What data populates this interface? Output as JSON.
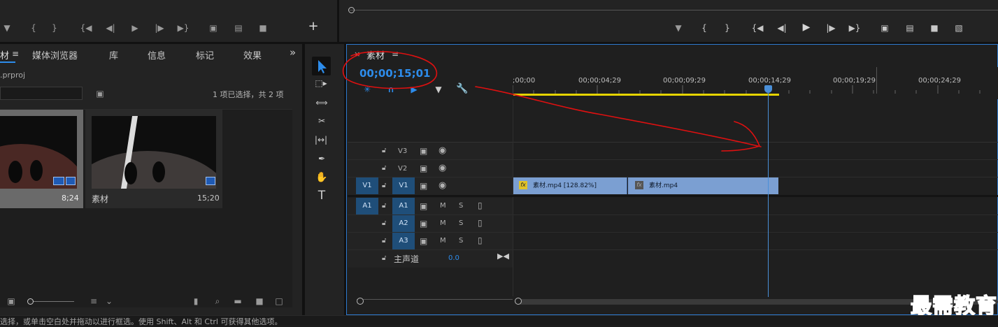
{
  "source_monitor": {
    "transport": [
      "marker-icon",
      "mark-in-icon",
      "mark-out-icon",
      "go-to-in-icon",
      "step-back-icon",
      "play-icon",
      "step-forward-icon",
      "go-to-out-icon",
      "insert-icon",
      "overwrite-icon",
      "export-frame-icon"
    ],
    "add_button": "+"
  },
  "program_monitor": {
    "transport": [
      "marker-icon",
      "mark-in-icon",
      "mark-out-icon",
      "go-to-in-icon",
      "step-back-icon",
      "play-icon",
      "step-forward-icon",
      "go-to-out-icon",
      "lift-icon",
      "extract-icon",
      "export-frame-icon",
      "compare-icon"
    ]
  },
  "project_panel": {
    "tabs": [
      "材",
      "媒体浏览器",
      "库",
      "信息",
      "标记",
      "效果"
    ],
    "more": "»",
    "file_name": ".prproj",
    "selection_status": "1 项已选择，共 2 项",
    "items": [
      {
        "name": "",
        "duration": "8;24"
      },
      {
        "name": "素材",
        "duration": "15;20"
      }
    ]
  },
  "timeline": {
    "sequence_name": "素材",
    "close": "×",
    "menu": "≡",
    "timecode": "00;00;15;01",
    "ruler_labels": [
      ";00;00",
      "00;00;04;29",
      "00;00;09;29",
      "00;00;14;29",
      "00;00;19;29",
      "00;00;24;29"
    ],
    "video_tracks": [
      {
        "name": "V3",
        "source": ""
      },
      {
        "name": "V2",
        "source": ""
      },
      {
        "name": "V1",
        "source": "V1"
      }
    ],
    "audio_tracks": [
      {
        "name": "A1",
        "source": "A1"
      },
      {
        "name": "A2",
        "source": ""
      },
      {
        "name": "A3",
        "source": ""
      }
    ],
    "mute": "M",
    "solo": "S",
    "master_label": "主声道",
    "master_value": "0.0",
    "clips": [
      {
        "name": "素材.mp4 [128.82%]",
        "badge": "fx"
      },
      {
        "name": "素材.mp4",
        "badge": "fx"
      }
    ]
  },
  "status_bar": {
    "text": "选择，或单击空白处并拖动以进行框选。使用 Shift、Alt 和 Ctrl 可获得其他选项。"
  },
  "watermark": "最需教育",
  "colors": {
    "accent_blue": "#2d8ceb",
    "clip_blue": "#7b9fd2",
    "work_area": "#e6d400",
    "annotation_red": "#e01010"
  }
}
